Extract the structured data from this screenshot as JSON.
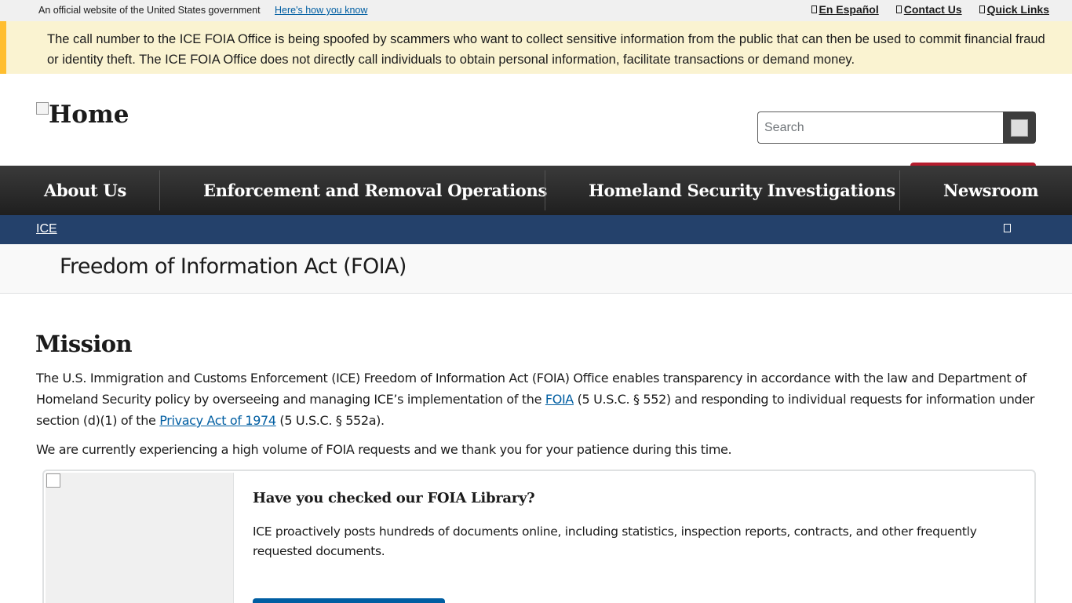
{
  "gov_banner": {
    "text": "An official website of the United States government",
    "link": "Here's how you know",
    "top_links": [
      "En Español",
      "Contact Us",
      "Quick Links"
    ]
  },
  "alert": {
    "text": "The call number to the ICE FOIA Office is being spoofed by scammers who want to collect sensitive information from the public that can then be used to commit financial fraud or identity theft. The ICE FOIA Office does not directly call individuals to obtain personal information, facilitate transactions or demand money."
  },
  "header": {
    "logo_alt": "Home",
    "search_placeholder": "Search"
  },
  "nav": {
    "items": [
      "About Us",
      "Enforcement and Removal Operations",
      "Homeland Security Investigations",
      "Newsroom"
    ]
  },
  "breadcrumb": {
    "link": "ICE"
  },
  "page": {
    "title": "Freedom of Information Act (FOIA)",
    "mission_heading": "Mission",
    "mission_p1_a": "The U.S. Immigration and Customs Enforcement (ICE) Freedom of Information Act (FOIA) Office enables transparency in accordance with the law and Department of Homeland Security policy by overseeing and managing ICE’s implementation of the ",
    "mission_p1_link1": "FOIA",
    "mission_p1_b": " (5 U.S.C. § 552) and responding to individual requests for information under section (d)(1) of the ",
    "mission_p1_link2": "Privacy Act of 1974",
    "mission_p1_c": " (5 U.S.C. § 552a).",
    "mission_p2": "We are currently experiencing a high volume of FOIA requests and we thank you for your patience during this time."
  },
  "card": {
    "title": "Have you checked our FOIA Library?",
    "text": "ICE proactively posts hundreds of documents online, including statistics, inspection reports, contracts, and other frequently requested documents."
  },
  "colors": {
    "alert_bg": "#faf3d1",
    "alert_border": "#ffbe2e",
    "nav_bg": "#2b2b2b",
    "breadcrumb_bg": "#24416b",
    "link": "#005ea2",
    "accent_red": "#b51d2e"
  }
}
